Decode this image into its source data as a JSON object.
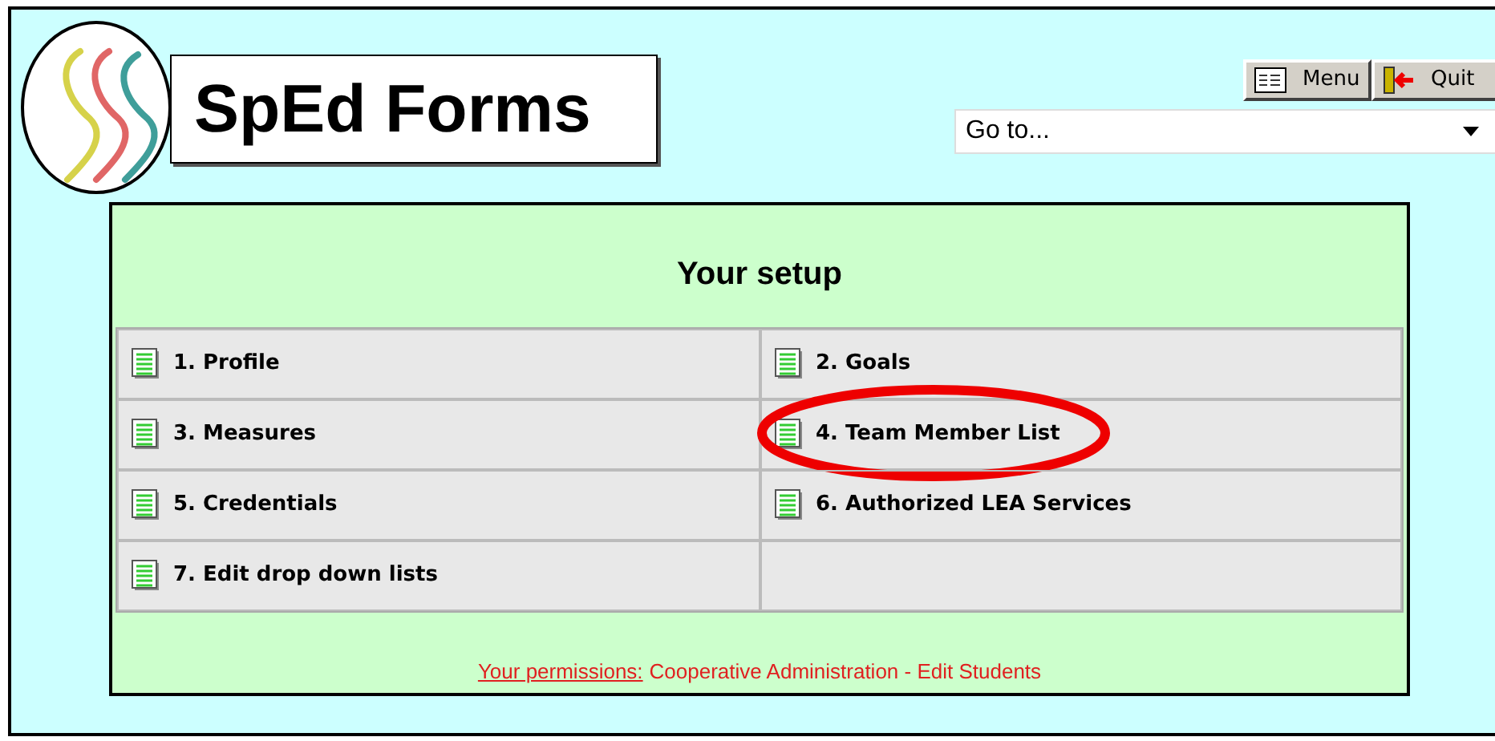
{
  "logo": {
    "title": "SpEd Forms"
  },
  "toolbar": {
    "buttons": [
      {
        "kind": "menu",
        "label": "Menu"
      },
      {
        "kind": "quit",
        "label": "Quit"
      }
    ]
  },
  "goto": {
    "value": "Go to..."
  },
  "panel": {
    "title": "Your setup",
    "items": [
      {
        "label": "1. Profile",
        "highlighted": false
      },
      {
        "label": "2. Goals",
        "highlighted": false
      },
      {
        "label": "3. Measures",
        "highlighted": false
      },
      {
        "label": "4. Team Member List",
        "highlighted": true
      },
      {
        "label": "5. Credentials",
        "highlighted": false
      },
      {
        "label": "6. Authorized LEA Services",
        "highlighted": false
      },
      {
        "label": "7. Edit drop down lists",
        "highlighted": false
      }
    ],
    "permissions": {
      "link": "Your permissions:",
      "text": "Cooperative Administration - Edit Students"
    }
  }
}
